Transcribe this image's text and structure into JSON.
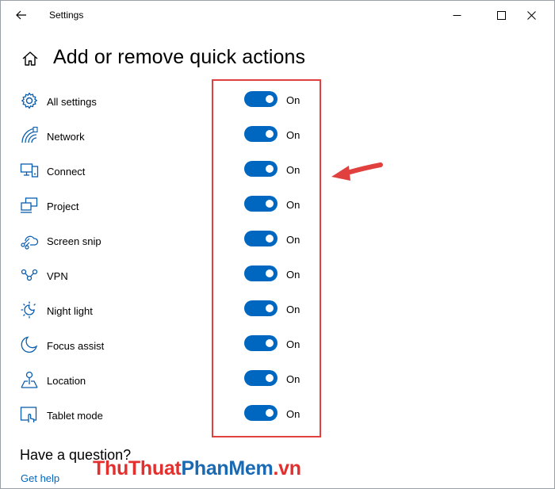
{
  "window": {
    "title": "Settings"
  },
  "header": {
    "title": "Add or remove quick actions"
  },
  "quick_actions": [
    {
      "label": "All settings",
      "state": "On",
      "icon": "gear-icon"
    },
    {
      "label": "Network",
      "state": "On",
      "icon": "network-icon"
    },
    {
      "label": "Connect",
      "state": "On",
      "icon": "connect-icon"
    },
    {
      "label": "Project",
      "state": "On",
      "icon": "project-icon"
    },
    {
      "label": "Screen snip",
      "state": "On",
      "icon": "screen-snip-icon"
    },
    {
      "label": "VPN",
      "state": "On",
      "icon": "vpn-icon"
    },
    {
      "label": "Night light",
      "state": "On",
      "icon": "night-light-icon"
    },
    {
      "label": "Focus assist",
      "state": "On",
      "icon": "focus-assist-icon"
    },
    {
      "label": "Location",
      "state": "On",
      "icon": "location-icon"
    },
    {
      "label": "Tablet mode",
      "state": "On",
      "icon": "tablet-mode-icon"
    }
  ],
  "footer": {
    "question": "Have a question?",
    "help_link": "Get help"
  },
  "watermark": {
    "part1": "ThuThuat",
    "part2": "PhanMem",
    "part3": ".vn"
  },
  "colors": {
    "accent": "#0067c0",
    "annotation": "#e0413f"
  }
}
